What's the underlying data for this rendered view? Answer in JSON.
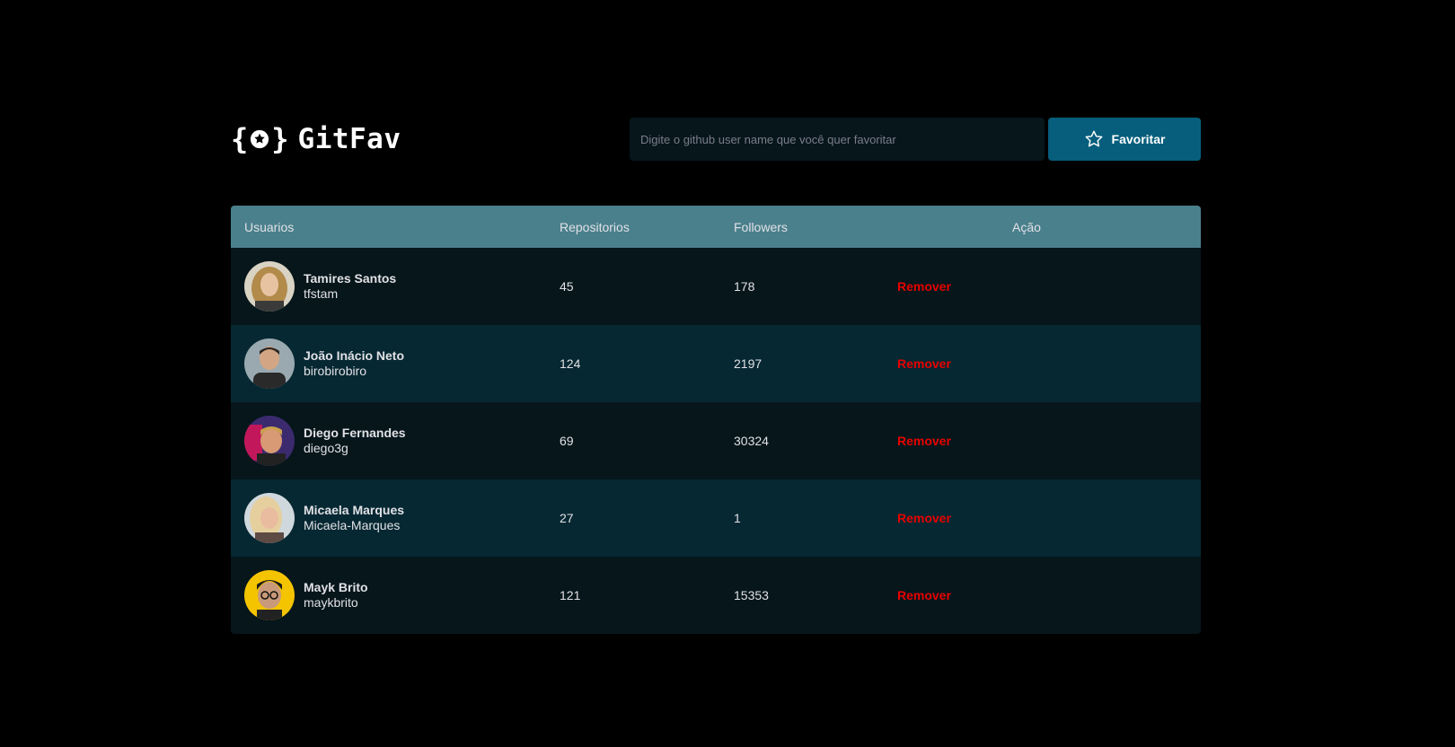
{
  "header": {
    "logo_text": "GitFav",
    "search_placeholder": "Digite o github user name que você quer favoritar",
    "favorite_button_label": "Favoritar",
    "logo_icon": "star-braces-icon",
    "button_icon": "star-icon"
  },
  "table": {
    "columns": [
      "Usuarios",
      "Repositorios",
      "Followers",
      "Ação"
    ],
    "header_color": "#4a808c",
    "rows": [
      {
        "name": "Tamires Santos",
        "login": "tfstam",
        "repositories": "45",
        "followers": "178",
        "action": "Remover"
      },
      {
        "name": "João Inácio Neto",
        "login": "birobirobiro",
        "repositories": "124",
        "followers": "2197",
        "action": "Remover"
      },
      {
        "name": "Diego Fernandes",
        "login": "diego3g",
        "repositories": "69",
        "followers": "30324",
        "action": "Remover"
      },
      {
        "name": "Micaela Marques",
        "login": "Micaela-Marques",
        "repositories": "27",
        "followers": "1",
        "action": "Remover"
      },
      {
        "name": "Mayk Brito",
        "login": "maykbrito",
        "repositories": "121",
        "followers": "15353",
        "action": "Remover"
      }
    ]
  },
  "colors": {
    "background": "#000000",
    "button": "#065e7c",
    "row_odd": "#06161b",
    "row_even": "#062832",
    "remove": "#e80000"
  }
}
